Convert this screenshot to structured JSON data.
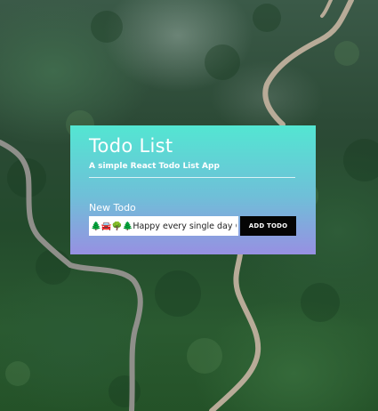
{
  "app": {
    "title": "Todo List",
    "subtitle": "A simple React Todo List App"
  },
  "form": {
    "section_label": "New Todo",
    "input_value": "🌲🚘🌳🌲Happy every single day 😓",
    "add_button_label": "ADD TODO"
  },
  "colors": {
    "card_gradient_top": "#53e6d2",
    "card_gradient_bottom": "#9790e2",
    "button_background": "#050505",
    "text_primary": "#ffffff"
  }
}
